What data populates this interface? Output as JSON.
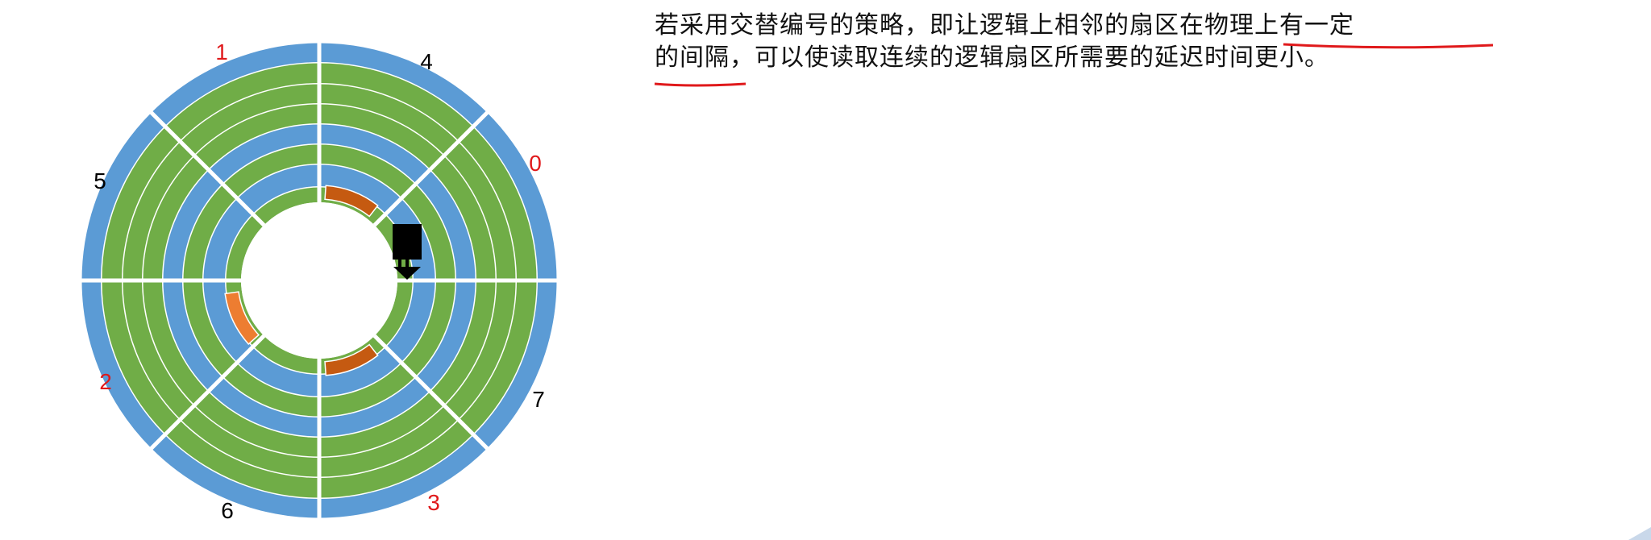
{
  "description": {
    "line1": "若采用交替编号的策略，即让逻辑上相邻的扇区在物理上有一定",
    "line2": "的间隔，可以使读取连续的逻辑扇区所需要的延迟时间更小。"
  },
  "sector_labels": [
    "0",
    "1",
    "2",
    "3",
    "4",
    "5",
    "6",
    "7"
  ],
  "colors": {
    "track_blue": "#5b9bd5",
    "track_green": "#70ad47",
    "highlight_dark_orange": "#c55a11",
    "highlight_orange": "#ed7d31",
    "label_red": "#e0191b",
    "label_black": "#000000",
    "underline_red": "#e0191b",
    "head_black": "#000000"
  }
}
